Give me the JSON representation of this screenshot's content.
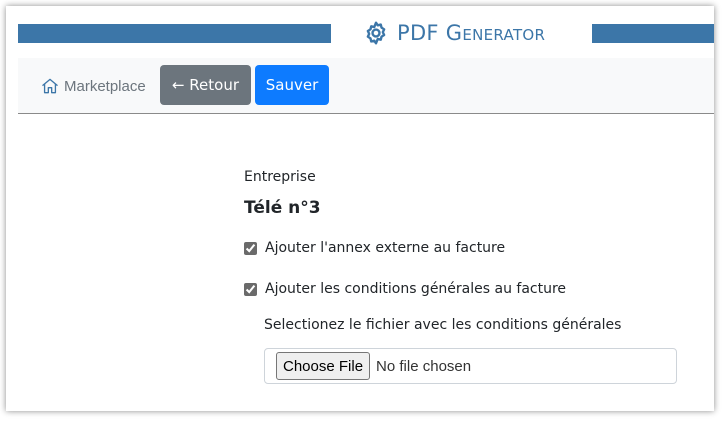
{
  "banner": {
    "title": "PDF Generator",
    "icon": "gear-icon",
    "color": "#3c76a8"
  },
  "toolbar": {
    "marketplace_label": "Marketplace",
    "marketplace_icon": "home-icon",
    "back_label": "← Retour",
    "save_label": "Sauver",
    "back_color": "#6c757d",
    "save_color": "#0d7bff"
  },
  "form": {
    "company_label": "Entreprise",
    "company_name": "Télé n°3",
    "options": [
      {
        "label": "Ajouter l'annex externe au facture",
        "checked": true
      },
      {
        "label": "Ajouter les conditions générales au facture",
        "checked": true
      }
    ],
    "file_label": "Selectionez le fichier avec les conditions générales",
    "choose_file_label": "Choose File",
    "file_status": "No file chosen"
  }
}
